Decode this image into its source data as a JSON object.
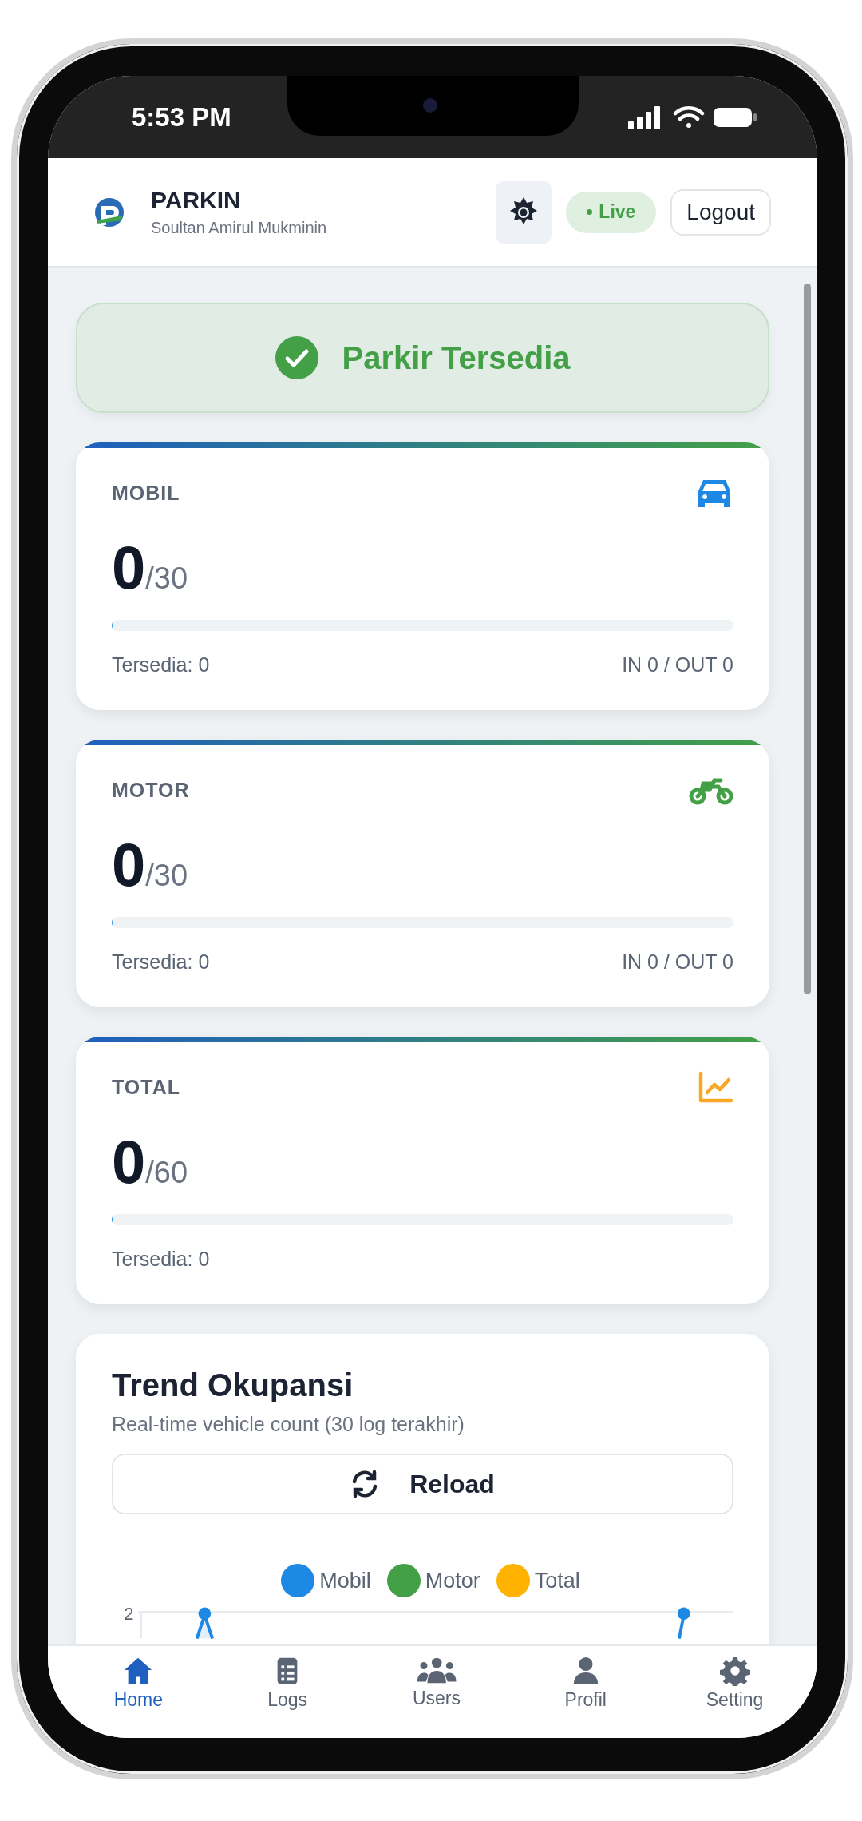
{
  "status_bar": {
    "time": "5:53 PM"
  },
  "header": {
    "title": "PARKIN",
    "subtitle": "Soultan Amirul Mukminin",
    "live": "Live",
    "logout": "Logout"
  },
  "banner": {
    "text": "Parkir Tersedia"
  },
  "cards": [
    {
      "kind": "car",
      "label": "MOBIL",
      "value": "0",
      "capacity": "/30",
      "level": 0,
      "available": "Tersedia: 0",
      "flow": "IN 0 / OUT 0"
    },
    {
      "kind": "motorcycle",
      "label": "MOTOR",
      "value": "0",
      "capacity": "/30",
      "level": 0,
      "available": "Tersedia: 0",
      "flow": "IN 0 / OUT 0"
    },
    {
      "kind": "chart",
      "label": "TOTAL",
      "value": "0",
      "capacity": "/60",
      "level": 0,
      "available": "Tersedia: 0"
    }
  ],
  "trend": {
    "title": "Trend Okupansi",
    "subtitle": "Real-time vehicle count (30 log terakhir)",
    "reload": "Reload",
    "legend": [
      {
        "label": "Mobil",
        "color": "#1e88e5"
      },
      {
        "label": "Motor",
        "color": "#43a047"
      },
      {
        "label": "Total",
        "color": "#ffb300"
      }
    ],
    "y_tick": "2"
  },
  "nav": [
    {
      "kind": "home",
      "label": "Home",
      "selected": true
    },
    {
      "kind": "logs",
      "label": "Logs",
      "selected": false
    },
    {
      "kind": "users",
      "label": "Users",
      "selected": false
    },
    {
      "kind": "profile",
      "label": "Profil",
      "selected": false
    },
    {
      "kind": "setting",
      "label": "Setting",
      "selected": false
    }
  ]
}
